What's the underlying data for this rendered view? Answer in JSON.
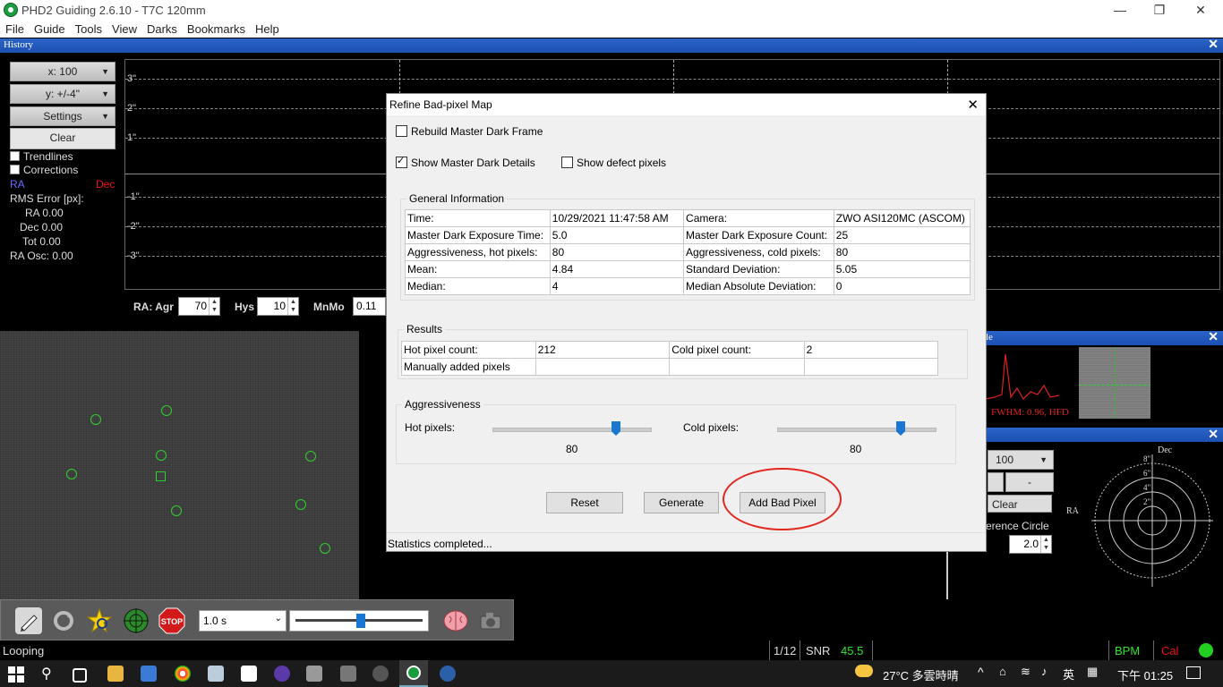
{
  "window": {
    "title": "PHD2 Guiding 2.6.10 - T7C 120mm",
    "min": "—",
    "max": "❐",
    "close": "✕"
  },
  "menu": [
    "File",
    "Guide",
    "Tools",
    "View",
    "Darks",
    "Bookmarks",
    "Help"
  ],
  "history": {
    "title": "History",
    "x_scale": "x: 100",
    "y_scale": "y: +/-4\"",
    "settings": "Settings",
    "clear": "Clear",
    "trendlines": "Trendlines",
    "corrections": "Corrections",
    "ra": "RA",
    "dec": "Dec",
    "rms_label": "RMS Error [px]:",
    "ra_rms": "RA 0.00",
    "dec_rms": "Dec 0.00",
    "tot_rms": "Tot 0.00",
    "ra_osc": "RA Osc: 0.00",
    "y_labels": [
      "3\"",
      "2\"",
      "1\"",
      "-1\"",
      "-2\"",
      "-3\""
    ],
    "ra_agr_label": "RA: Agr",
    "ra_agr": "70",
    "hys_label": "Hys",
    "hys": "10",
    "mnmo_label": "MnMo",
    "mnmo": "0.11"
  },
  "toolbar": {
    "exposure": "1.0 s"
  },
  "profile_panel": {
    "fwhm": "FWHM: 0.96, HFD"
  },
  "target_panel": {
    "scale": "100",
    "minus": "-",
    "clear": "Clear",
    "ref_circle": "erence Circle",
    "ref_value": "2.0",
    "dec": "Dec",
    "ra": "RA",
    "rings": [
      "8\"",
      "6\"",
      "4\"",
      "2\""
    ]
  },
  "statusbar": {
    "state": "Looping",
    "frame": "1/12",
    "snr_label": "SNR",
    "snr": "45.5",
    "bpm": "BPM",
    "cal": "Cal"
  },
  "taskbar": {
    "weather": "27°C 多雲時晴",
    "ime": "英",
    "time": "下午 01:25"
  },
  "dialog": {
    "title": "Refine Bad-pixel Map",
    "rebuild": "Rebuild Master Dark Frame",
    "show_details": "Show Master Dark Details",
    "show_defects": "Show defect pixels",
    "general_info": "General Information",
    "info_rows": [
      [
        "Time:",
        "10/29/2021  11:47:58 AM",
        "Camera:",
        "ZWO ASI120MC (ASCOM)"
      ],
      [
        "Master Dark Exposure Time:",
        "5.0",
        "Master Dark Exposure Count:",
        "25"
      ],
      [
        "Aggressiveness, hot pixels:",
        "80",
        "Aggressiveness, cold pixels:",
        "80"
      ],
      [
        "Mean:",
        "4.84",
        "Standard Deviation:",
        "5.05"
      ],
      [
        "Median:",
        "4",
        "Median Absolute Deviation:",
        "0"
      ]
    ],
    "results": "Results",
    "result_rows": [
      [
        "Hot pixel count:",
        "212",
        "Cold pixel count:",
        "2"
      ],
      [
        "Manually added pixels",
        "",
        "",
        ""
      ]
    ],
    "aggressiveness": "Aggressiveness",
    "hot_label": "Hot pixels:",
    "hot_value": "80",
    "cold_label": "Cold pixels:",
    "cold_value": "80",
    "reset": "Reset",
    "generate": "Generate",
    "add_bad_pixel": "Add Bad Pixel",
    "status": "Statistics completed..."
  }
}
